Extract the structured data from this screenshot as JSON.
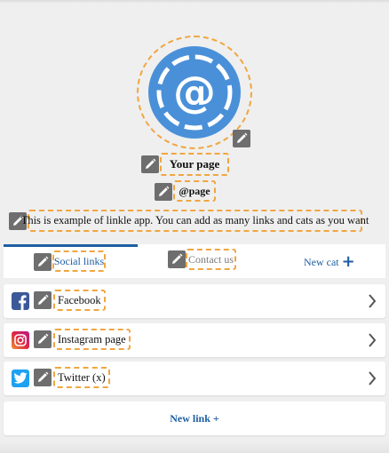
{
  "profile": {
    "title": "Your page",
    "handle": "@page",
    "description": "This is example of linkle app. You can add as many links and cats as you want",
    "avatar_icon": "at-sign-icon"
  },
  "tabs": [
    {
      "label": "Social links",
      "active": true
    },
    {
      "label": "Contact us",
      "active": false
    }
  ],
  "new_cat_label": "New cat",
  "links": [
    {
      "label": "Facebook",
      "icon": "facebook-icon",
      "color": "#3b5998"
    },
    {
      "label": "Instagram page",
      "icon": "instagram-icon",
      "color": "#c13584"
    },
    {
      "label": "Twitter (x)",
      "icon": "twitter-icon",
      "color": "#1da1f2"
    }
  ],
  "new_link_label": "New link +",
  "colors": {
    "accent": "#1f5fa0",
    "edit_outline": "#f0a640",
    "edit_button": "#6e6e6e",
    "avatar_blue": "#4a90d9"
  }
}
